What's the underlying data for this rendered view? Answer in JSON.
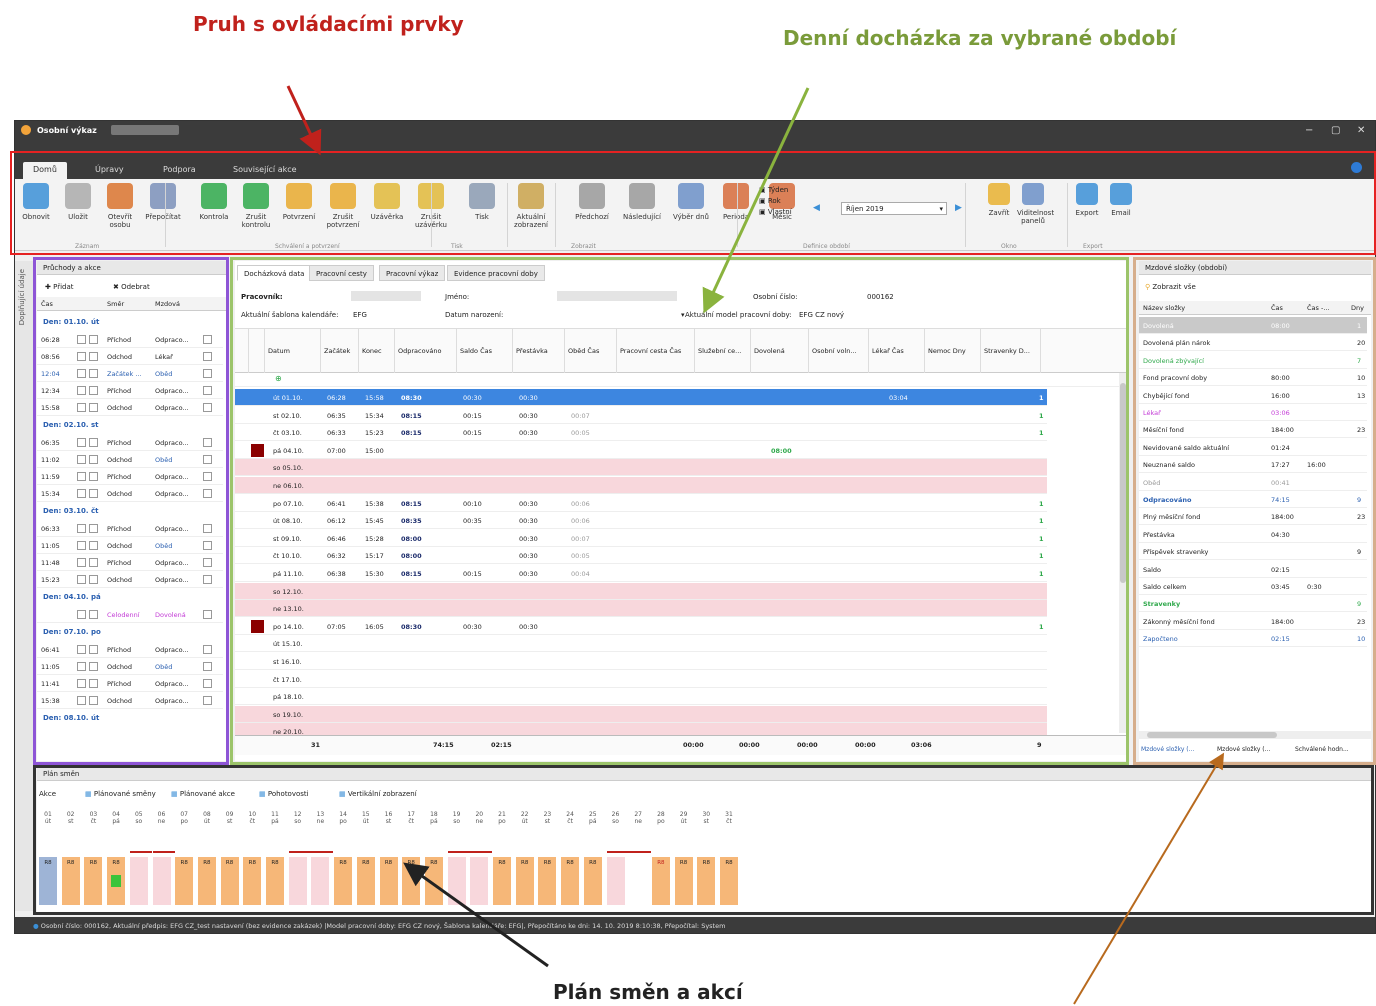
{
  "callouts": {
    "top_left": "Pruh s ovládacími prvky",
    "top_right": "Denní docházka za vybrané období",
    "bottom": "Plán směn a akcí"
  },
  "window": {
    "title": "Osobní výkaz",
    "controls": [
      "−",
      "▢",
      "✕"
    ]
  },
  "ribbon_tabs": [
    "Domů",
    "Úpravy",
    "Podpora",
    "Související akce"
  ],
  "ribbon": {
    "buttons": [
      {
        "label": "Obnovit",
        "icon": "refresh-icon",
        "color": "#3b8fd6"
      },
      {
        "label": "Uložit",
        "icon": "save-icon",
        "color": "#aaaaaa"
      },
      {
        "label": "Otevřít osobu",
        "icon": "person-icon",
        "color": "#d9732e"
      },
      {
        "label": "Přepočítat",
        "icon": "calculator-icon",
        "color": "#7a8fb8"
      },
      {
        "label": "Kontrola",
        "icon": "check-icon",
        "color": "#2ea84a"
      },
      {
        "label": "Zrušit kontrolu",
        "icon": "check-cancel-icon",
        "color": "#2ea84a"
      },
      {
        "label": "Potvrzení",
        "icon": "hand-icon",
        "color": "#e8a92e"
      },
      {
        "label": "Zrušit potvrzení",
        "icon": "hand-cancel-icon",
        "color": "#e8a92e"
      },
      {
        "label": "Uzávěrka",
        "icon": "lock-icon",
        "color": "#e0b83a"
      },
      {
        "label": "Zrušit uzávěrku",
        "icon": "unlock-icon",
        "color": "#e0b83a"
      },
      {
        "label": "Tisk",
        "icon": "printer-icon",
        "color": "#8a9ab0"
      },
      {
        "label": "Aktuální zobrazení",
        "icon": "chart-icon",
        "color": "#c9a24a"
      },
      {
        "label": "Předchozí",
        "icon": "up-arrow-icon",
        "color": "#999999"
      },
      {
        "label": "Následující",
        "icon": "down-arrow-icon",
        "color": "#999999"
      },
      {
        "label": "Výběr dnů",
        "icon": "calendar-range-icon",
        "color": "#6b8fc7"
      },
      {
        "label": "Perioda",
        "icon": "calendar-12-icon",
        "color": "#d66b3b"
      },
      {
        "label": "Měsíc",
        "icon": "calendar-31-icon",
        "color": "#d66b3b"
      }
    ],
    "period_options": [
      "Týden",
      "Rok",
      "Vlastní"
    ],
    "period_select": "Říjen 2019",
    "right_buttons": [
      {
        "label": "Zavřít",
        "icon": "folder-close-icon",
        "color": "#e8b030"
      },
      {
        "label": "Viditelnost panelů",
        "icon": "panels-icon",
        "color": "#6b8fc7"
      },
      {
        "label": "Export",
        "icon": "export-icon",
        "color": "#3b8fd6"
      },
      {
        "label": "Email",
        "icon": "email-icon",
        "color": "#3b8fd6"
      }
    ],
    "groups": [
      "Záznam",
      "Schválení a potvrzení",
      "Tisk",
      "Zobrazit",
      "Definice období",
      "Okno",
      "Export"
    ]
  },
  "left_panel": {
    "title": "Průchody a akce",
    "vertical_tab": "Doplňující údaje",
    "add": "Přidat",
    "remove": "Odebrat",
    "cols": [
      "Čas",
      "Směr",
      "Mzdová"
    ],
    "groups": [
      {
        "title": "Den: 01.10. út",
        "rows": [
          [
            "06:28",
            "Příchod",
            "Odpraco..."
          ],
          [
            "08:56",
            "Odchod",
            "Lékař"
          ],
          [
            "12:04",
            "Začátek ...",
            "Oběd"
          ],
          [
            "12:34",
            "Příchod",
            "Odpraco..."
          ],
          [
            "15:58",
            "Odchod",
            "Odpraco..."
          ]
        ]
      },
      {
        "title": "Den: 02.10. st",
        "rows": [
          [
            "06:35",
            "Příchod",
            "Odpraco..."
          ],
          [
            "11:02",
            "Odchod",
            "Oběd"
          ],
          [
            "11:59",
            "Příchod",
            "Odpraco..."
          ],
          [
            "15:34",
            "Odchod",
            "Odpraco..."
          ]
        ]
      },
      {
        "title": "Den: 03.10. čt",
        "rows": [
          [
            "06:33",
            "Příchod",
            "Odpraco..."
          ],
          [
            "11:05",
            "Odchod",
            "Oběd"
          ],
          [
            "11:48",
            "Příchod",
            "Odpraco..."
          ],
          [
            "15:23",
            "Odchod",
            "Odpraco..."
          ]
        ]
      },
      {
        "title": "Den: 04.10. pá",
        "rows": [
          [
            "",
            "Celodenní",
            "Dovolená"
          ]
        ]
      },
      {
        "title": "Den: 07.10. po",
        "rows": [
          [
            "06:41",
            "Příchod",
            "Odpraco..."
          ],
          [
            "11:05",
            "Odchod",
            "Oběd"
          ],
          [
            "11:41",
            "Příchod",
            "Odpraco..."
          ],
          [
            "15:38",
            "Odchod",
            "Odpraco..."
          ]
        ]
      },
      {
        "title": "Den: 08.10. út",
        "rows": []
      }
    ]
  },
  "center": {
    "tabs": [
      "Docházková data",
      "Pracovní cesty",
      "Pracovní výkaz",
      "Evidence pracovní doby"
    ],
    "info": {
      "employee_label": "Pracovník:",
      "dept_label": "Jméno:",
      "os_label": "Osobní číslo:",
      "os_value": "000162",
      "calendar_label": "Aktuální šablona kalendáře:",
      "calendar_value": "EFG",
      "date_label": "Datum narození:",
      "model_label": "Aktuální model pracovní doby:",
      "model_value": "EFG CZ nový"
    },
    "columns": [
      "Datum",
      "Začátek",
      "Konec",
      "Odpracováno",
      "Saldo Čas",
      "Přestávka",
      "Oběd Čas",
      "Pracovní cesta Čas",
      "Služební ce...",
      "Dovolená",
      "Osobní voln...",
      "Lékař Čas",
      "Nemoc Dny",
      "Stravenky D..."
    ],
    "rows": [
      {
        "d": "út 01.10.",
        "s": "06:28",
        "e": "15:58",
        "w": "08:30",
        "sa": "00:30",
        "p": "00:30",
        "o": "",
        "l": "03:04",
        "st": "1",
        "sel": true
      },
      {
        "d": "st 02.10.",
        "s": "06:35",
        "e": "15:34",
        "w": "08:15",
        "sa": "00:15",
        "p": "00:30",
        "o": "00:07",
        "l": "",
        "st": "1"
      },
      {
        "d": "čt 03.10.",
        "s": "06:33",
        "e": "15:23",
        "w": "08:15",
        "sa": "00:15",
        "p": "00:30",
        "o": "00:05",
        "l": "",
        "st": "1"
      },
      {
        "d": "pá 04.10.",
        "s": "07:00",
        "e": "15:00",
        "w": "",
        "sa": "",
        "p": "",
        "o": "",
        "l": "",
        "st": "",
        "mark": true,
        "dov": "08:00"
      },
      {
        "d": "so 05.10.",
        "wk": true
      },
      {
        "d": "ne 06.10.",
        "wk": true
      },
      {
        "d": "po 07.10.",
        "s": "06:41",
        "e": "15:38",
        "w": "08:15",
        "sa": "00:10",
        "p": "00:30",
        "o": "00:06",
        "l": "",
        "st": "1"
      },
      {
        "d": "út 08.10.",
        "s": "06:12",
        "e": "15:45",
        "w": "08:35",
        "sa": "00:35",
        "p": "00:30",
        "o": "00:06",
        "l": "",
        "st": "1"
      },
      {
        "d": "st 09.10.",
        "s": "06:46",
        "e": "15:28",
        "w": "08:00",
        "sa": "",
        "p": "00:30",
        "o": "00:07",
        "l": "",
        "st": "1"
      },
      {
        "d": "čt 10.10.",
        "s": "06:32",
        "e": "15:17",
        "w": "08:00",
        "sa": "",
        "p": "00:30",
        "o": "00:05",
        "l": "",
        "st": "1"
      },
      {
        "d": "pá 11.10.",
        "s": "06:38",
        "e": "15:30",
        "w": "08:15",
        "sa": "00:15",
        "p": "00:30",
        "o": "00:04",
        "l": "",
        "st": "1"
      },
      {
        "d": "so 12.10.",
        "wk": true
      },
      {
        "d": "ne 13.10.",
        "wk": true
      },
      {
        "d": "po 14.10.",
        "s": "07:05",
        "e": "16:05",
        "w": "08:30",
        "sa": "00:30",
        "p": "00:30",
        "o": "",
        "l": "",
        "st": "1",
        "mark": true
      },
      {
        "d": "út 15.10."
      },
      {
        "d": "st 16.10."
      },
      {
        "d": "čt 17.10."
      },
      {
        "d": "pá 18.10."
      },
      {
        "d": "so 19.10.",
        "wk": true
      },
      {
        "d": "ne 20.10.",
        "wk": true
      }
    ],
    "totals": {
      "d": "31",
      "w": "74:15",
      "sa": "02:15",
      "c1": "00:00",
      "c2": "00:00",
      "c3": "00:00",
      "c4": "00:00",
      "l": "03:06",
      "st": "9"
    }
  },
  "right_panel": {
    "title": "Mzdové složky (období)",
    "filter": "Zobrazit vše",
    "cols": [
      "Název složky",
      "Čas",
      "Čas -...",
      "Dny"
    ],
    "rows": [
      {
        "n": "Dovolená",
        "c": "08:00",
        "c2": "",
        "d": "1",
        "sel": true
      },
      {
        "n": "Dovolená plán nárok",
        "c": "",
        "c2": "",
        "d": "20"
      },
      {
        "n": "Dovolená zbývající",
        "c": "",
        "c2": "",
        "d": "7",
        "color": "#2ea84a"
      },
      {
        "n": "Fond pracovní doby",
        "c": "80:00",
        "c2": "",
        "d": "10"
      },
      {
        "n": "Chybějící fond",
        "c": "16:00",
        "c2": "",
        "d": "13"
      },
      {
        "n": "Lékař",
        "c": "03:06",
        "c2": "",
        "d": "",
        "color": "#c33ad6"
      },
      {
        "n": "Měsíční fond",
        "c": "184:00",
        "c2": "",
        "d": "23"
      },
      {
        "n": "Nevidované saldo aktuální",
        "c": "01:24",
        "c2": "",
        "d": ""
      },
      {
        "n": "Neuznané saldo",
        "c": "17:27",
        "c2": "16:00",
        "d": ""
      },
      {
        "n": "Oběd",
        "c": "00:41",
        "c2": "",
        "d": "",
        "color": "#999999"
      },
      {
        "n": "Odpracováno",
        "c": "74:15",
        "c2": "",
        "d": "9",
        "color": "#2a5fb0",
        "bold": true
      },
      {
        "n": "Plný měsíční fond",
        "c": "184:00",
        "c2": "",
        "d": "23"
      },
      {
        "n": "Přestávka",
        "c": "04:30",
        "c2": "",
        "d": ""
      },
      {
        "n": "Příspěvek stravenky",
        "c": "",
        "c2": "",
        "d": "9"
      },
      {
        "n": "Saldo",
        "c": "02:15",
        "c2": "",
        "d": ""
      },
      {
        "n": "Saldo celkem",
        "c": "03:45",
        "c2": "0:30",
        "d": ""
      },
      {
        "n": "Stravenky",
        "c": "",
        "c2": "",
        "d": "9",
        "color": "#2ea84a",
        "bold": true
      },
      {
        "n": "Zákonný měsíční fond",
        "c": "184:00",
        "c2": "",
        "d": "23"
      },
      {
        "n": "Započteno",
        "c": "02:15",
        "c2": "",
        "d": "10",
        "color": "#2a5fb0"
      }
    ],
    "bottom_tabs": [
      "Mzdové složky (...",
      "Mzdové složky (...",
      "Schválené hodn..."
    ]
  },
  "plan": {
    "title": "Plán směn",
    "toolbar": [
      "Akce",
      "Plánované směny",
      "Plánované akce",
      "Pohotovosti",
      "Vertikální zobrazení"
    ],
    "days": [
      [
        "01",
        "út"
      ],
      [
        "02",
        "st"
      ],
      [
        "03",
        "čt"
      ],
      [
        "04",
        "pá"
      ],
      [
        "05",
        "so"
      ],
      [
        "06",
        "ne"
      ],
      [
        "07",
        "po"
      ],
      [
        "08",
        "út"
      ],
      [
        "09",
        "st"
      ],
      [
        "10",
        "čt"
      ],
      [
        "11",
        "pá"
      ],
      [
        "12",
        "so"
      ],
      [
        "13",
        "ne"
      ],
      [
        "14",
        "po"
      ],
      [
        "15",
        "út"
      ],
      [
        "16",
        "st"
      ],
      [
        "17",
        "čt"
      ],
      [
        "18",
        "pá"
      ],
      [
        "19",
        "so"
      ],
      [
        "20",
        "ne"
      ],
      [
        "21",
        "po"
      ],
      [
        "22",
        "út"
      ],
      [
        "23",
        "st"
      ],
      [
        "24",
        "čt"
      ],
      [
        "25",
        "pá"
      ],
      [
        "26",
        "so"
      ],
      [
        "27",
        "ne"
      ],
      [
        "28",
        "po"
      ],
      [
        "29",
        "út"
      ],
      [
        "30",
        "st"
      ],
      [
        "31",
        "čt"
      ]
    ],
    "shift_label": "R8"
  },
  "status": "Osobní číslo: 000162, Aktuální předpis: EFG CZ_test nastavení (bez evidence zakázek) |Model pracovní doby: EFG CZ nový, Šablona kalendáře: EFG|, Přepočítáno ke dni: 14. 10. 2019 8:10:38, Přepočítal: System"
}
